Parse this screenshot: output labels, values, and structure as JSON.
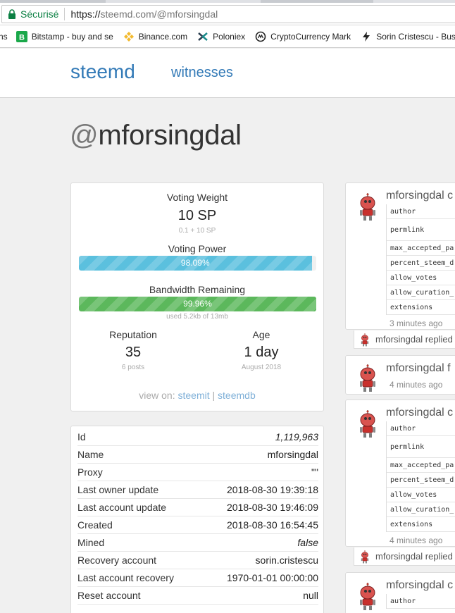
{
  "browser": {
    "secure_label": "Sécurisé",
    "url_protocol": "https://",
    "url_rest": "steemd.com/@mforsingdal",
    "bookmarks": [
      {
        "label": "ns",
        "icon": "none"
      },
      {
        "label": "Bitstamp - buy and se",
        "icon": "bitstamp-icon"
      },
      {
        "label": "Binance.com",
        "icon": "binance-icon"
      },
      {
        "label": "Poloniex",
        "icon": "poloniex-icon"
      },
      {
        "label": "CryptoCurrency Mark",
        "icon": "coinmarketcap-icon"
      },
      {
        "label": "Sorin Cristescu - Busy",
        "icon": "busy-icon"
      }
    ]
  },
  "site": {
    "brand": "steemd",
    "nav_witnesses": "witnesses",
    "page_title_at": "@",
    "page_title_name": "mforsingdal"
  },
  "stats": {
    "voting_weight_label": "Voting Weight",
    "voting_weight_value": "10 SP",
    "voting_weight_detail": "0.1 + 10 SP",
    "voting_power_label": "Voting Power",
    "voting_power_text": "98.09%",
    "voting_power_pct": 98.09,
    "bandwidth_label": "Bandwidth Remaining",
    "bandwidth_text": "99.96%",
    "bandwidth_pct": 99.96,
    "bandwidth_detail": "used 5.2kb of 13mb",
    "reputation_label": "Reputation",
    "reputation_value": "35",
    "reputation_detail": "6 posts",
    "age_label": "Age",
    "age_value": "1 day",
    "age_detail": "August 2018",
    "view_on": "view on:",
    "link_steemit": "steemit",
    "link_divider": "|",
    "link_steemdb": "steemdb"
  },
  "account": {
    "rows": [
      {
        "key": "Id",
        "value": "1,119,963",
        "italic": true
      },
      {
        "key": "Name",
        "value": "mforsingdal",
        "italic": false
      },
      {
        "key": "Proxy",
        "value": "\"\"",
        "italic": false
      },
      {
        "key": "Last owner update",
        "value": "2018-08-30 19:39:18",
        "italic": false
      },
      {
        "key": "Last account update",
        "value": "2018-08-30 19:46:09",
        "italic": false
      },
      {
        "key": "Created",
        "value": "2018-08-30 16:54:45",
        "italic": false
      },
      {
        "key": "Mined",
        "value": "false",
        "italic": true
      },
      {
        "key": "Recovery account",
        "value": "sorin.cristescu",
        "italic": false
      },
      {
        "key": "Last account recovery",
        "value": "1970-01-01 00:00:00",
        "italic": false
      },
      {
        "key": "Reset account",
        "value": "null",
        "italic": false
      }
    ]
  },
  "activity": {
    "op1": {
      "title": "mforsingdal c",
      "keys": [
        "author",
        "permlink",
        "max_accepted_pa",
        "percent_steem_d",
        "allow_votes",
        "allow_curation_",
        "extensions"
      ],
      "time": "3 minutes ago"
    },
    "reply1": "mforsingdal replied",
    "op2": {
      "title": "mforsingdal f",
      "time": "4 minutes ago"
    },
    "op3": {
      "title": "mforsingdal c",
      "keys": [
        "author",
        "permlink",
        "max_accepted_pa",
        "percent_steem_d",
        "allow_votes",
        "allow_curation_",
        "extensions"
      ],
      "time": "4 minutes ago"
    },
    "reply2": "mforsingdal replied",
    "op4": {
      "title": "mforsingdal c",
      "keys": [
        "author"
      ]
    }
  },
  "colors": {
    "link": "#337ab7",
    "voting_bar": "#5bc0de",
    "bandwidth_bar": "#5cb85c",
    "secure": "#0b8043"
  }
}
